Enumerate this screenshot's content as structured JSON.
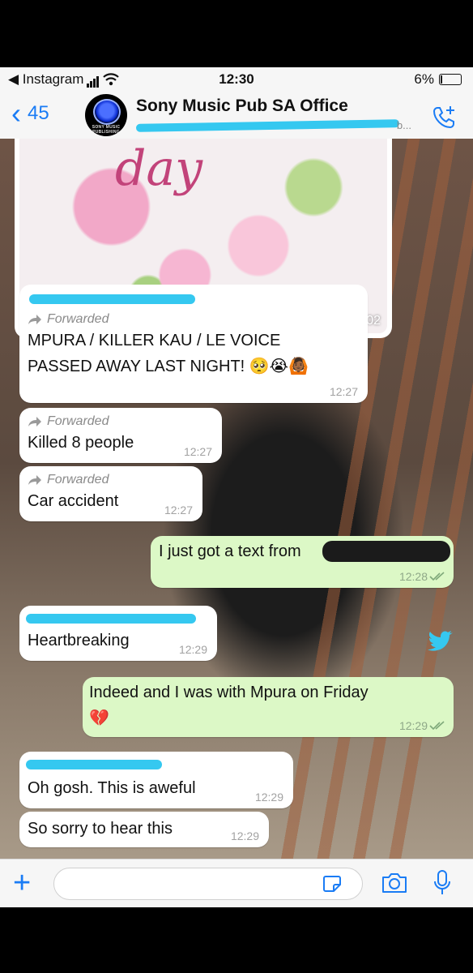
{
  "status": {
    "back_app": "◀ Instagram",
    "time": "12:30",
    "battery": "6%"
  },
  "header": {
    "back_count": "45",
    "title": "Sony Music Pub SA Office",
    "subtitle_ellipsis": "b...",
    "avatar_caption": "SONY MUSIC PUBLISHING"
  },
  "messages": {
    "image_time": "09:02",
    "m1": {
      "forwarded": "Forwarded",
      "line1": "MPURA / KILLER KAU / LE VOICE",
      "line2": "PASSED AWAY LAST NIGHT! 🥺😭🙆🏾",
      "time": "12:27"
    },
    "m2": {
      "forwarded": "Forwarded",
      "text": "Killed 8 people",
      "time": "12:27"
    },
    "m3": {
      "forwarded": "Forwarded",
      "text": "Car accident",
      "time": "12:27"
    },
    "m4": {
      "text": "I just got a text from",
      "time": "12:28"
    },
    "m5": {
      "text": "Heartbreaking",
      "time": "12:29"
    },
    "m6": {
      "line1": "Indeed and I was with Mpura on Friday",
      "line2": "💔",
      "time": "12:29"
    },
    "m7": {
      "text": "Oh gosh. This is aweful",
      "time": "12:29"
    },
    "m8": {
      "text": "So sorry to hear this",
      "time": "12:29"
    }
  },
  "colors": {
    "accent": "#1a7cf5",
    "incoming": "#ffffff",
    "outgoing": "#dcf8c6",
    "redaction": "#35c8f0"
  },
  "icons": [
    "back-chevron-icon",
    "add-call-icon",
    "forward-icon",
    "double-check-icon",
    "plus-icon",
    "sticker-icon",
    "camera-icon",
    "mic-icon",
    "twitter-bird-icon"
  ]
}
